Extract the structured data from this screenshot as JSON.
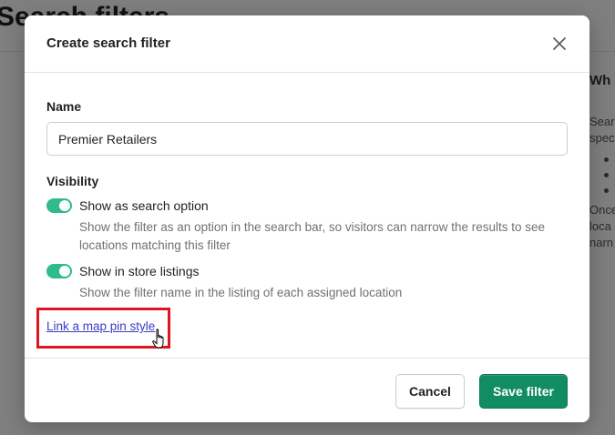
{
  "background": {
    "page_title": "Search filters",
    "side_heading": "Wh",
    "side_lines_1": [
      "Sear",
      "spec"
    ],
    "side_lines_2": [
      "Once",
      "loca",
      "narn"
    ]
  },
  "modal": {
    "title": "Create search filter",
    "close_icon": "close-icon",
    "name_label": "Name",
    "name_value": "Premier Retailers",
    "visibility_label": "Visibility",
    "toggles": [
      {
        "label": "Show as search option",
        "on": true,
        "help": "Show the filter as an option in the search bar, so visitors can narrow the results to see locations matching this filter"
      },
      {
        "label": "Show in store listings",
        "on": true,
        "help": "Show the filter name in the listing of each assigned location"
      }
    ],
    "link_label": "Link a map pin style",
    "cancel_label": "Cancel",
    "save_label": "Save filter"
  },
  "colors": {
    "toggle_on": "#2fbb8c",
    "primary": "#128c62",
    "link": "#3b3bc8",
    "highlight": "#e0141e"
  }
}
